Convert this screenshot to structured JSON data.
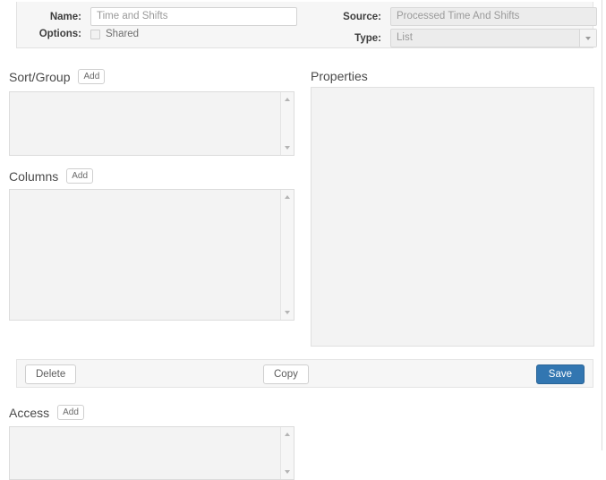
{
  "form": {
    "name": {
      "label": "Name:",
      "value": "Time and Shifts"
    },
    "options": {
      "label": "Options:",
      "checkbox_label": "Shared",
      "checked": false
    },
    "source": {
      "label": "Source:",
      "value": "Processed Time And Shifts",
      "disabled": true
    },
    "type": {
      "label": "Type:",
      "value": "List",
      "disabled": true
    }
  },
  "sections": {
    "sort_group": {
      "title": "Sort/Group",
      "add_label": "Add",
      "items": []
    },
    "columns": {
      "title": "Columns",
      "add_label": "Add",
      "items": []
    },
    "properties": {
      "title": "Properties",
      "items": []
    },
    "access": {
      "title": "Access",
      "add_label": "Add",
      "items": []
    }
  },
  "buttons": {
    "delete": "Delete",
    "copy": "Copy",
    "save": "Save"
  },
  "colors": {
    "save_bg": "#3276b1",
    "panel_bg": "#f6f6f6",
    "listbox_bg": "#f3f3f3"
  }
}
